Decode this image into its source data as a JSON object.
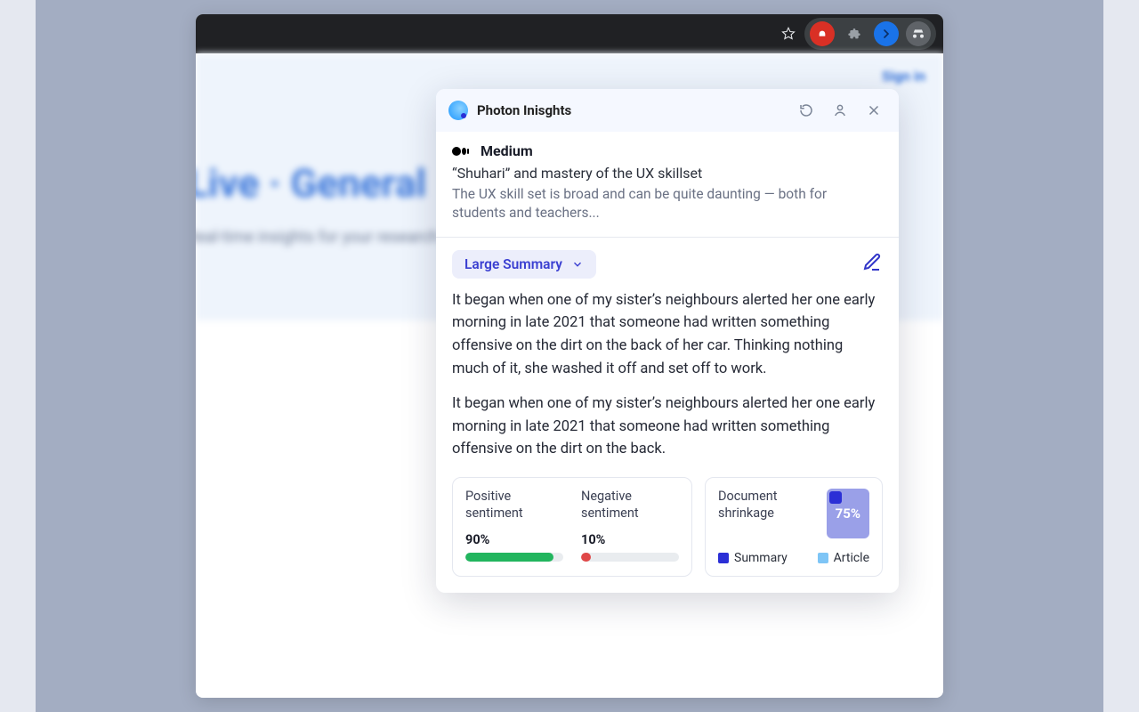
{
  "browser": {
    "icons": [
      "star",
      "block",
      "puzzle",
      "arrow",
      "incognito"
    ]
  },
  "background": {
    "title": "Live · General",
    "subtitle": "Real-time insights for your research"
  },
  "popup": {
    "title": "Photon Inisghts"
  },
  "source": {
    "name": "Medium",
    "article_title": "“Shuhari” and mastery of the UX skillset",
    "article_desc": "The UX skill set is broad and can be quite daunting — both for students and teachers..."
  },
  "summary": {
    "mode": "Large Summary",
    "paragraphs": [
      "It began when one of my sister’s neighbours alerted her one early morning in late 2021 that someone had written something offensive on the dirt on the back of her car. Thinking nothing much of it, she washed it off and set off to work.",
      "It began when one of my sister’s neighbours alerted her one early morning in late 2021 that someone had written something offensive on the dirt on the back."
    ]
  },
  "sentiment": {
    "positive": {
      "label": "Positive sentiment",
      "pct_text": "90%",
      "pct": 90
    },
    "negative": {
      "label": "Negative sentiment",
      "pct_text": "10%",
      "pct": 10
    }
  },
  "shrinkage": {
    "label": "Document shrinkage",
    "value_text": "75%",
    "value": 75,
    "legend": {
      "summary": "Summary",
      "article": "Article"
    }
  }
}
